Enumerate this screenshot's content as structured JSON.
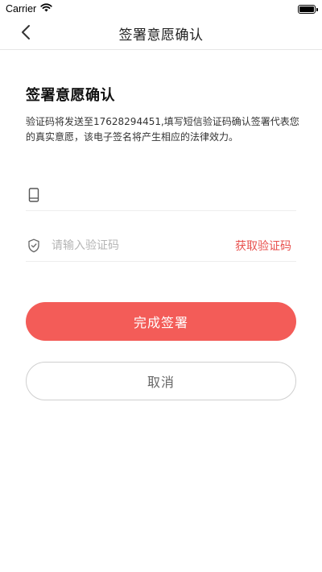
{
  "status_bar": {
    "carrier": "Carrier",
    "wifi_icon": "wifi-icon",
    "battery_icon": "battery-icon"
  },
  "nav": {
    "back_icon": "chevron-left-icon",
    "title": "签署意愿确认"
  },
  "content": {
    "heading": "签署意愿确认",
    "description": "验证码将发送至17628294451,填写短信验证码确认签署代表您的真实意愿，该电子签名将产生相应的法律效力。"
  },
  "phone_field": {
    "icon": "phone-icon",
    "value": "",
    "placeholder": ""
  },
  "code_field": {
    "icon": "shield-icon",
    "value": "",
    "placeholder": "请输入验证码",
    "get_code_label": "获取验证码"
  },
  "actions": {
    "confirm_label": "完成签署",
    "cancel_label": "取消"
  },
  "colors": {
    "accent": "#f35c58",
    "link": "#e8504d"
  }
}
